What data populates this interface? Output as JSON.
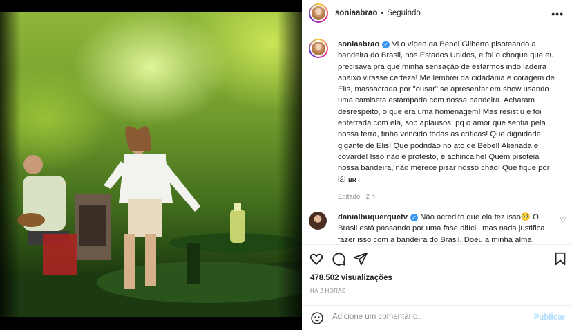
{
  "post": {
    "username": "soniaabrao",
    "follow_status": "Seguindo",
    "separator": "•",
    "more_icon": "more-options-icon"
  },
  "caption": {
    "username": "soniaabrao",
    "text": "Vi o vídeo da Bebel Gilberto pisoteando a bandeira do Brasil, nos Estados Unidos, e foi o choque que eu precisava pra que minha sensação de estarmos indo ladeira abaixo virasse certeza! Me lembrei da cidadania e coragem de Elis, massacrada por \"ousar\" se apresentar em show usando uma camiseta estampada com nossa bandeira. Acharam desrespeito, o que era uma homenagem! Mas resistiu e foi enterrada com ela, sob aplausos, pq o amor que sentia pela nossa terra, tinha vencido todas as críticas! Que dignidade gigante de Elis! Que podridão no ato de Bebel! Alienada e covarde! Isso não é protesto, é achincalhe! Quem pisoteia nossa bandeira, não merece pisar nosso chão! Que fique por lá!",
    "flag": "BR",
    "edited_label": "Editado",
    "time": "2 h"
  },
  "comment": {
    "username": "danialbuquerquetv",
    "text": "Não acredito que ela fez isso🥺 O Brasil está passando por uma fase difícil, mas nada justifica fazer isso com a bandeira do Brasil. Doeu a minha alma. Lamentável"
  },
  "stats": {
    "views": "478.502 visualizações",
    "time_ago": "HÁ 2 HORAS"
  },
  "add_comment": {
    "placeholder": "Adicione um comentário...",
    "publish": "Publicar"
  },
  "colors": {
    "link_blue": "#3897f0",
    "muted": "#8e8e8e",
    "publish_disabled": "#b2dffc"
  }
}
